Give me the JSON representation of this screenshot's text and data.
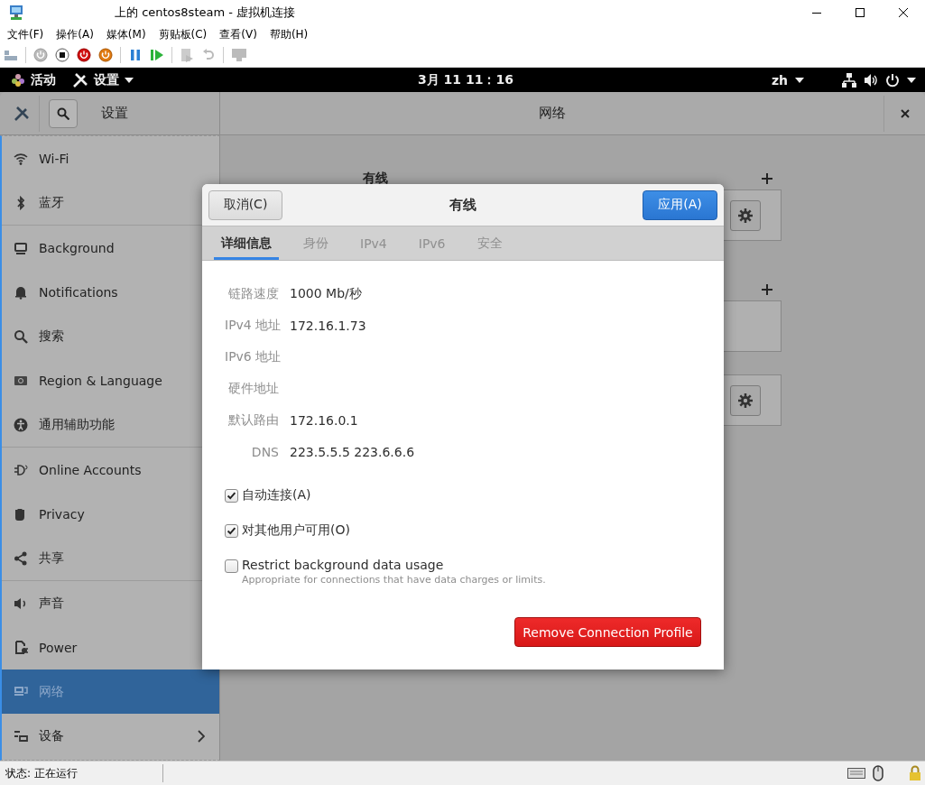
{
  "window": {
    "title": "上的 centos8steam - 虚拟机连接"
  },
  "menu": [
    "文件(F)",
    "操作(A)",
    "媒体(M)",
    "剪贴板(C)",
    "查看(V)",
    "帮助(H)"
  ],
  "top_bar": {
    "activities": "活动",
    "app_menu": "设置",
    "clock": "3月 11  11：16",
    "input_method": "zh"
  },
  "settings": {
    "title": "设置",
    "panel_title": "网络"
  },
  "sidebar": {
    "groups": [
      [
        {
          "label": "Wi-Fi",
          "selected": false,
          "has_submenu": false
        },
        {
          "label": "蓝牙",
          "selected": false,
          "has_submenu": false
        }
      ],
      [
        {
          "label": "Background",
          "selected": false,
          "has_submenu": false
        },
        {
          "label": "Notifications",
          "selected": false,
          "has_submenu": false
        },
        {
          "label": "搜索",
          "selected": false,
          "has_submenu": false
        },
        {
          "label": "Region & Language",
          "selected": false,
          "has_submenu": false
        },
        {
          "label": "通用辅助功能",
          "selected": false,
          "has_submenu": false
        }
      ],
      [
        {
          "label": "Online Accounts",
          "selected": false,
          "has_submenu": false
        },
        {
          "label": "Privacy",
          "selected": false,
          "has_submenu": false
        },
        {
          "label": "共享",
          "selected": false,
          "has_submenu": false
        }
      ],
      [
        {
          "label": "声音",
          "selected": false,
          "has_submenu": false
        },
        {
          "label": "Power",
          "selected": false,
          "has_submenu": false
        },
        {
          "label": "网络",
          "selected": true,
          "has_submenu": false
        },
        {
          "label": "设备",
          "selected": false,
          "has_submenu": true
        }
      ]
    ]
  },
  "network_page": {
    "wired_heading": "有线"
  },
  "dialog": {
    "cancel": "取消(C)",
    "title": "有线",
    "apply": "应用(A)",
    "tabs": [
      {
        "label": "详细信息",
        "selected": true
      },
      {
        "label": "身份",
        "selected": false
      },
      {
        "label": "IPv4",
        "selected": false
      },
      {
        "label": "IPv6",
        "selected": false
      },
      {
        "label": "安全",
        "selected": false
      }
    ],
    "details": [
      {
        "label": "链路速度",
        "value": "1000 Mb/秒"
      },
      {
        "label": "IPv4 地址",
        "value": "172.16.1.73"
      },
      {
        "label": "IPv6 地址"
      },
      {
        "label": "硬件地址"
      },
      {
        "label": "默认路由",
        "value": "172.16.0.1"
      },
      {
        "label": "DNS",
        "value": "223.5.5.5 223.6.6.6"
      }
    ],
    "options": [
      {
        "label": "自动连接(A)",
        "checked": true
      },
      {
        "label": "对其他用户可用(O)",
        "checked": true
      },
      {
        "label": "Restrict background data usage",
        "description": "Appropriate for connections that have data charges or limits.",
        "checked": false
      }
    ],
    "remove": "Remove Connection Profile"
  },
  "status_bar": {
    "text": "状态: 正在运行"
  }
}
